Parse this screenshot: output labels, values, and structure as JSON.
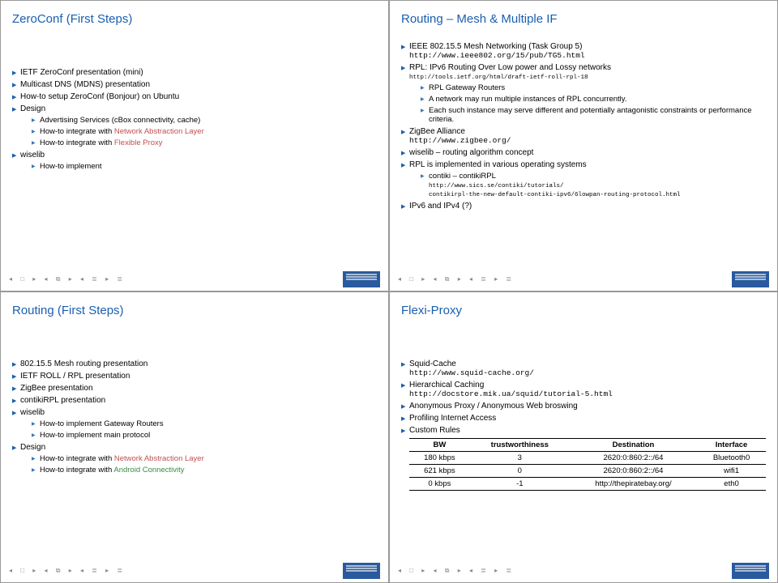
{
  "slides": {
    "tl": {
      "title": "ZeroConf (First Steps)",
      "items": [
        "IETF ZeroConf presentation (mini)",
        "Multicast DNS (MDNS) presentation",
        "How-to setup ZeroConf (Bonjour) on Ubuntu",
        "Design",
        "wiselib"
      ],
      "design_sub": {
        "a": "Advertising Services (cBox connectivity, cache)",
        "b_pre": "How-to integrate with ",
        "b_link": "Network Abstraction Layer",
        "c_pre": "How-to integrate with ",
        "c_link": "Flexible Proxy"
      },
      "wiselib_sub": [
        "How-to implement"
      ]
    },
    "tr": {
      "title": "Routing – Mesh & Multiple IF",
      "ieee_text": "IEEE 802.15.5 Mesh Networking (Task Group 5)",
      "ieee_url": "http://www.ieee802.org/15/pub/TG5.html",
      "rpl_text": "RPL: IPv6 Routing Over Low power and Lossy networks",
      "rpl_url": "http://tools.ietf.org/html/draft-ietf-roll-rpl-18",
      "rpl_sub": [
        "RPL Gateway Routers",
        "A network may run multiple instances of RPL concurrently.",
        "Each such instance may serve different and potentially antagonistic constraints or performance criteria."
      ],
      "zigbee_text": "ZigBee Alliance",
      "zigbee_url": "http://www.zigbee.org/",
      "wiselib_text": "wiselib – routing algorithm concept",
      "rpl_impl": "RPL is implemented in various operating systems",
      "contiki": "contiki – contikiRPL",
      "contiki_url1": "http://www.sics.se/contiki/tutorials/",
      "contiki_url2": "contikirpl-the-new-default-contiki-ipv6/6lowpan-routing-protocol.html",
      "ipv": "IPv6 and IPv4 (?)"
    },
    "bl": {
      "title": "Routing (First Steps)",
      "items": [
        "802.15.5 Mesh routing presentation",
        "IETF ROLL / RPL presentation",
        "ZigBee presentation",
        "contikiRPL presentation",
        "wiselib",
        "Design"
      ],
      "wiselib_sub": [
        "How-to implement Gateway Routers",
        "How-to implement main protocol"
      ],
      "design_sub": {
        "a_pre": "How-to integrate with ",
        "a_link": "Network Abstraction Layer",
        "b_pre": "How-to integrate with ",
        "b_link": "Android Connectivity"
      }
    },
    "br": {
      "title": "Flexi-Proxy",
      "squid": "Squid-Cache",
      "squid_url": "http://www.squid-cache.org/",
      "hier": "Hierarchical Caching",
      "hier_url": "http://docstore.mik.ua/squid/tutorial-5.html",
      "anon": "Anonymous Proxy / Anonymous Web broswing",
      "prof": "Profiling Internet Access",
      "rules": "Custom Rules",
      "table": {
        "headers": [
          "BW",
          "trustworthiness",
          "Destination",
          "Interface"
        ],
        "rows": [
          [
            "180 kbps",
            "3",
            "2620:0:860:2::/64",
            "Bluetooth0"
          ],
          [
            "621 kbps",
            "0",
            "2620:0:860:2::/64",
            "wifi1"
          ],
          [
            "0 kbps",
            "-1",
            "http://thepiratebay.org/",
            "eth0"
          ]
        ]
      }
    }
  },
  "nav_dots": "◂ □ ▸ ◂ ⧉ ▸ ◂ ≣ ▸ ≣"
}
